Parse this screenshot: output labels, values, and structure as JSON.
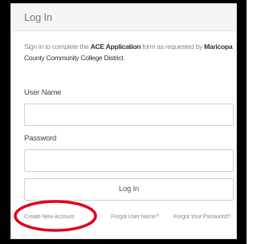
{
  "login": {
    "title": "Log In",
    "intro": {
      "part1": "Sign in to complete the ",
      "app_name": "ACE Application",
      "part2": " form as requested by ",
      "org_line1": "Maricopa",
      "org_line2": "County Community College District",
      "end": "."
    },
    "username": {
      "label": "User Name",
      "value": ""
    },
    "password": {
      "label": "Password",
      "value": ""
    },
    "submit_label": "Log In",
    "links": {
      "create_account": "Create New Account",
      "forgot_username": "Forgot User Name?",
      "forgot_password": "Forgot Your Password?"
    }
  },
  "colors": {
    "frame": "#000000",
    "annotation_circle": "#e0001b",
    "header_bg": "#f5f5f5"
  }
}
